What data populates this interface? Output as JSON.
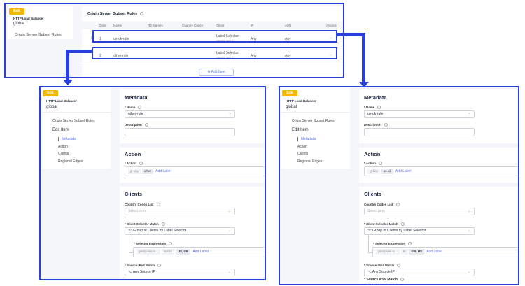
{
  "badge": "Edit",
  "object_type": "HTTP Load Balancer",
  "namespace": "global",
  "top": {
    "nav_item": "Origin Server Subset Rules",
    "title": "Origin Server Subset Rules",
    "columns": [
      "Order",
      "Name",
      "RE Names",
      "Country Codes",
      "Client",
      "IP",
      "ASN",
      "Actions"
    ],
    "rows": [
      {
        "order": "1",
        "name": "us-uk-rule",
        "client1": "Label Selector:",
        "client2": "geoip.ves.i...",
        "ip": "Any",
        "asn": "Any",
        "more": "⋯"
      },
      {
        "order": "2",
        "name": "other-rule",
        "client1": "Label Selector:",
        "client2": "geoip.ves.i...",
        "ip": "Any",
        "asn": "Any",
        "more": "⋯"
      }
    ],
    "add_item": "Add Item"
  },
  "tree": {
    "parent": "Origin Server Subset Rules",
    "edit": "Edit Item",
    "items": [
      "Metadata",
      "Action",
      "Clients",
      "Regional Edges"
    ]
  },
  "form_labels": {
    "metadata": "Metadata",
    "name": "* Name",
    "description": "Description",
    "action_title": "Action",
    "action": "* Action",
    "clients": "Clients",
    "country_codes": "Country Codes List",
    "select_item": "Select item",
    "client_selector": "* Client Selector Match",
    "client_selector_value": "Group of Clients by Label Selector",
    "selector_expression": "* Selector Expression",
    "source_ipv4": "* Source IPv4 Match",
    "source_ipv4_value": "Any Source IP",
    "source_asn": "* Source ASN Match",
    "add_label": "Add Label",
    "clear": "×",
    "key": "jy-key",
    "expr_key": "geoip.ves.io..."
  },
  "left_form": {
    "name": "other-rule",
    "action_value": "other",
    "operator": "Not In",
    "values": "US, GB"
  },
  "right_form": {
    "name": "us-uk-rule",
    "action_value": "us-uk",
    "operator": "In",
    "values": "GB, US"
  }
}
